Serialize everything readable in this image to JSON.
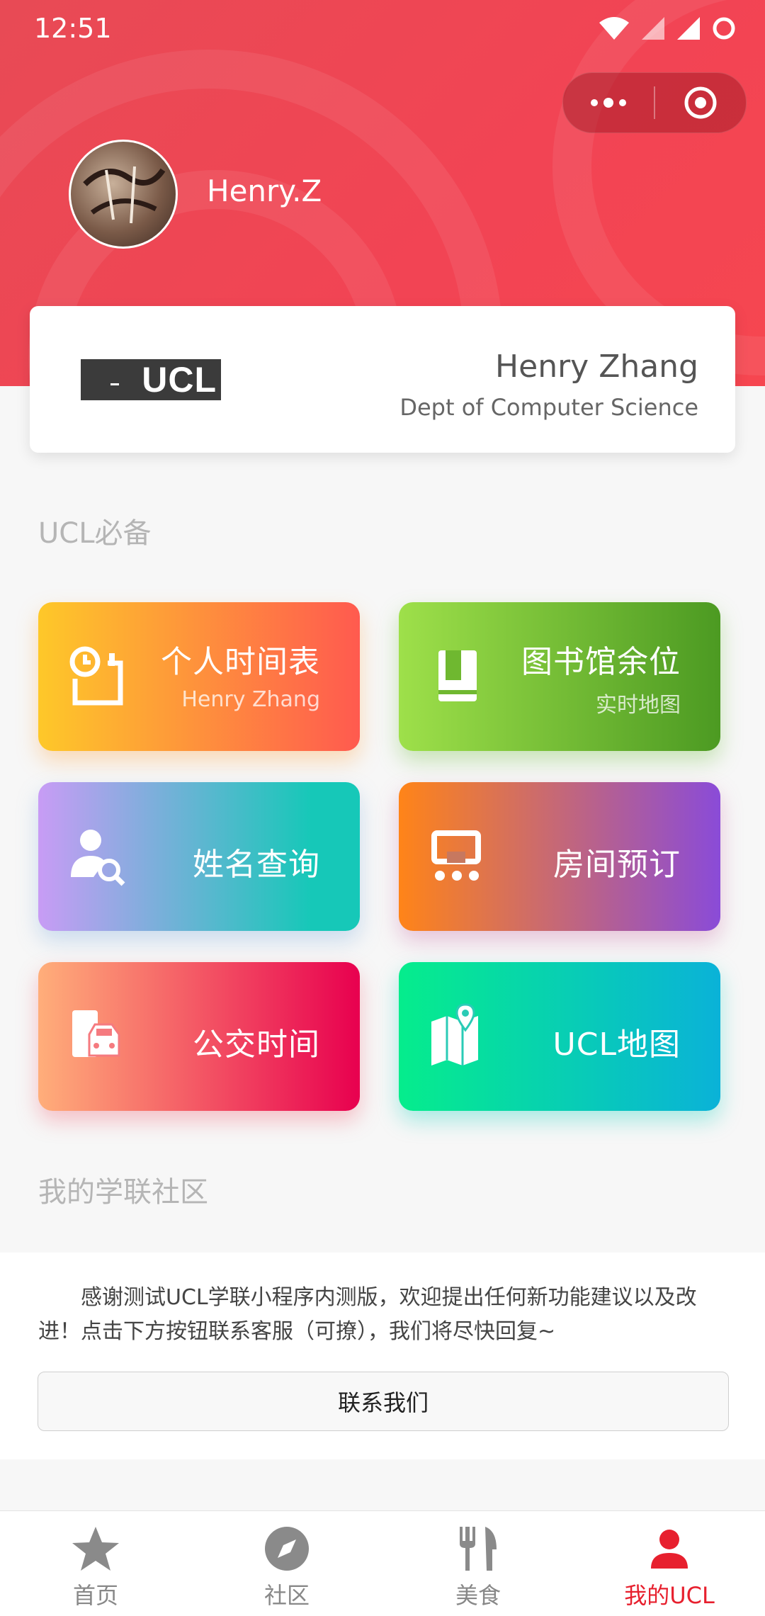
{
  "status_bar": {
    "time": "12:51"
  },
  "profile": {
    "nickname": "Henry.Z"
  },
  "id_card": {
    "logo_text": "UCL",
    "name": "Henry Zhang",
    "department": "Dept of Computer Science"
  },
  "sections": {
    "essentials": "UCL必备",
    "community": "我的学联社区"
  },
  "tiles": [
    {
      "title": "个人时间表",
      "subtitle": "Henry Zhang",
      "icon": "timetable-icon"
    },
    {
      "title": "图书馆余位",
      "subtitle": "实时地图",
      "icon": "library-book-icon"
    },
    {
      "title": "姓名查询",
      "icon": "person-search-icon"
    },
    {
      "title": "房间预订",
      "icon": "room-booking-icon"
    },
    {
      "title": "公交时间",
      "icon": "bus-icon"
    },
    {
      "title": "UCL地图",
      "icon": "map-pin-icon"
    }
  ],
  "notice": {
    "text": "感谢测试UCL学联小程序内测版，欢迎提出任何新功能建议以及改进！点击下方按钮联系客服（可撩），我们将尽快回复~",
    "button_label": "联系我们"
  },
  "tabbar": [
    {
      "label": "首页",
      "icon": "star-icon"
    },
    {
      "label": "社区",
      "icon": "compass-icon"
    },
    {
      "label": "美食",
      "icon": "fork-knife-icon"
    },
    {
      "label": "我的UCL",
      "icon": "person-icon",
      "active": true
    }
  ],
  "colors": {
    "brand_red": "#f24454",
    "active_tab": "#e7202e"
  }
}
